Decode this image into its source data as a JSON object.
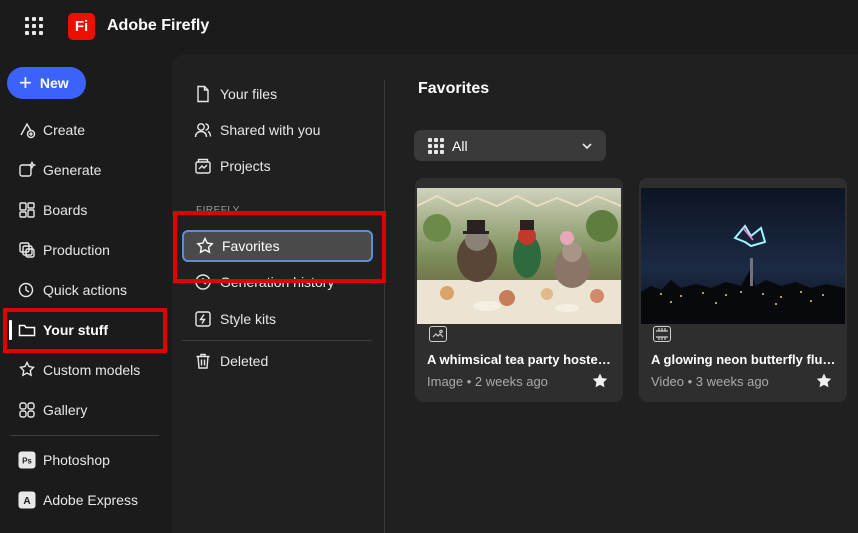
{
  "app": {
    "title": "Adobe Firefly",
    "logo_text": "Fi"
  },
  "nav": {
    "new_label": "New",
    "items": [
      {
        "label": "Create",
        "icon": "create-icon"
      },
      {
        "label": "Generate",
        "icon": "generate-icon"
      },
      {
        "label": "Boards",
        "icon": "boards-icon"
      },
      {
        "label": "Production",
        "icon": "production-icon"
      },
      {
        "label": "Quick actions",
        "icon": "quick-actions-icon"
      },
      {
        "label": "Your stuff",
        "icon": "folder-icon",
        "active": true
      },
      {
        "label": "Custom models",
        "icon": "custom-models-icon"
      },
      {
        "label": "Gallery",
        "icon": "gallery-icon"
      }
    ],
    "apps": [
      {
        "label": "Photoshop",
        "icon": "photoshop-icon",
        "badge": "Ps"
      },
      {
        "label": "Adobe Express",
        "icon": "adobe-express-icon",
        "badge": "A"
      }
    ]
  },
  "subnav": {
    "items": [
      {
        "label": "Your files",
        "icon": "file-icon"
      },
      {
        "label": "Shared with you",
        "icon": "shared-icon"
      },
      {
        "label": "Projects",
        "icon": "projects-icon"
      }
    ],
    "section_label": "FIREFLY",
    "favorites_label": "Favorites",
    "generation_history_label": "Generation history",
    "style_kits_label": "Style kits",
    "deleted_label": "Deleted"
  },
  "content": {
    "title": "Favorites",
    "filter": {
      "selected": "All"
    },
    "cards": [
      {
        "title": "A whimsical tea party hosted ...",
        "meta": "Image • 2 weeks ago",
        "type": "image-icon",
        "starred": true
      },
      {
        "title": "A glowing neon butterfly flutt...",
        "meta": "Video • 3 weeks ago",
        "type": "video-icon",
        "starred": true
      }
    ]
  },
  "colors": {
    "accent": "#3b63fb",
    "logo": "#eb1000",
    "highlight_box": "#e00000",
    "focus_ring": "#5b90d8"
  }
}
